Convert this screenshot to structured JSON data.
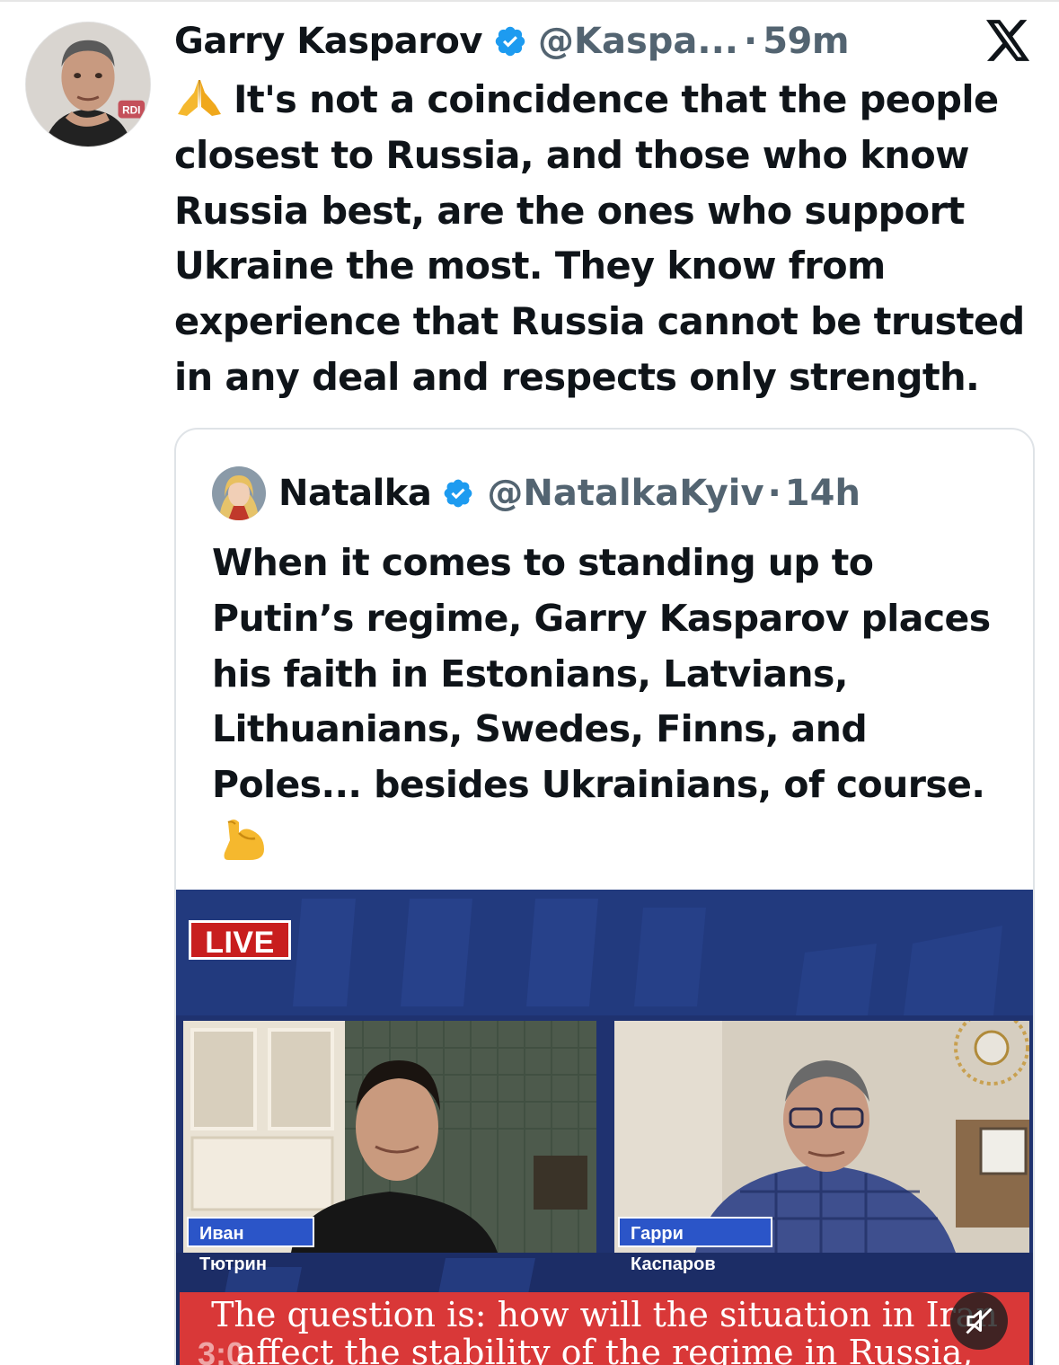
{
  "tweet": {
    "author_name": "Garry Kasparov",
    "author_handle": "@Kaspa...",
    "separator": "·",
    "time": "59m",
    "text": "It's not a coincidence that the people closest to Russia, and those who know Russia best, are the ones who support Ukraine the most. They know from experience that Russia cannot be trusted in any deal and respects only strength.",
    "avatar_badge_text": "RDI"
  },
  "quoted": {
    "author_name": "Natalka",
    "author_handle": "@NatalkaKyiv",
    "separator": "·",
    "time": "14h",
    "text": "When it comes to standing up to Putin’s regime, Garry Kasparov places his faith in Estonians, Latvians, Lithuanians, Swedes, Finns, and Poles... besides Ukrainians, of course."
  },
  "video": {
    "live_label": "LIVE",
    "left_name": "Иван Тютрин",
    "right_name": "Гарри Каспаров",
    "subtitle_line1": "The question is: how will the situation in Iran",
    "subtitle_line2": "affect the stability of the regime in Russia,",
    "timecode": "3:0"
  },
  "icons": {
    "verified": "verified-badge-icon",
    "platform": "x-logo-icon",
    "pray": "folded-hands-emoji",
    "muscle": "flexed-biceps-emoji",
    "mute": "speaker-muted-icon"
  },
  "colors": {
    "verified_blue": "#1d9bf0",
    "muted_text": "#536471",
    "live_red": "#c81e1e",
    "subtitle_red": "#d93838",
    "name_tag_blue": "#2b55c8"
  }
}
